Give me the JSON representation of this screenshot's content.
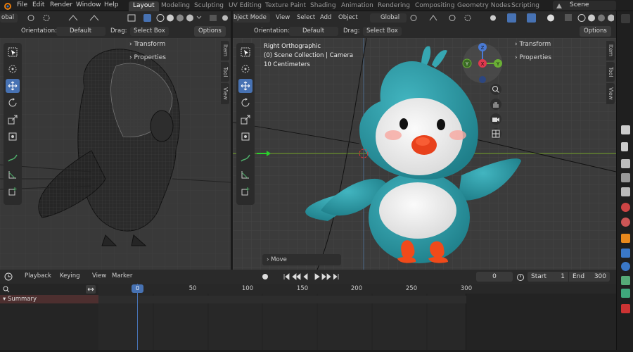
{
  "menu": {
    "items": [
      "File",
      "Edit",
      "Render",
      "Window",
      "Help"
    ]
  },
  "workspaces": [
    "Layout",
    "Modeling",
    "Sculpting",
    "UV Editing",
    "Texture Paint",
    "Shading",
    "Animation",
    "Rendering",
    "Compositing",
    "Geometry Nodes",
    "Scripting"
  ],
  "active_workspace": "Layout",
  "scene_label": "Scene",
  "left_viewport": {
    "header_transform": "obal",
    "orientation_label": "Orientation:",
    "orientation_value": "Default",
    "drag_label": "Drag:",
    "drag_value": "Select Box",
    "options_label": "Options",
    "npanel": {
      "transform": "Transform",
      "properties": "Properties"
    },
    "side_tabs": [
      "Item",
      "Tool",
      "View"
    ]
  },
  "right_viewport": {
    "mode": "bject Mode",
    "menu": [
      "View",
      "Select",
      "Add",
      "Object"
    ],
    "transform_space": "Global",
    "orientation_label": "Orientation:",
    "orientation_value": "Default",
    "drag_label": "Drag:",
    "drag_value": "Select Box",
    "options_label": "Options",
    "overlay_text": {
      "line1": "Right Orthographic",
      "line2": "(0) Scene Collection | Camera",
      "line3": "10 Centimeters"
    },
    "gizmo_axes": {
      "z": "Z",
      "y": "Y",
      "x": "X",
      "neg_y": "Y"
    },
    "npanel": {
      "transform": "Transform",
      "properties": "Properties"
    },
    "side_tabs": [
      "Item",
      "Tool",
      "View"
    ],
    "operator_panel": "Move"
  },
  "timeline": {
    "menus": [
      "Playback",
      "Keying",
      "View",
      "Marker"
    ],
    "current_frame": "0",
    "start_label": "Start",
    "start_value": "1",
    "end_label": "End",
    "end_value": "300",
    "ruler": [
      "0",
      "50",
      "100",
      "150",
      "200",
      "250",
      "300"
    ],
    "summary_label": "Summary"
  },
  "colors": {
    "accent": "#4772b3",
    "teal": "#2f9aa6",
    "playhead": "#4772b3"
  }
}
